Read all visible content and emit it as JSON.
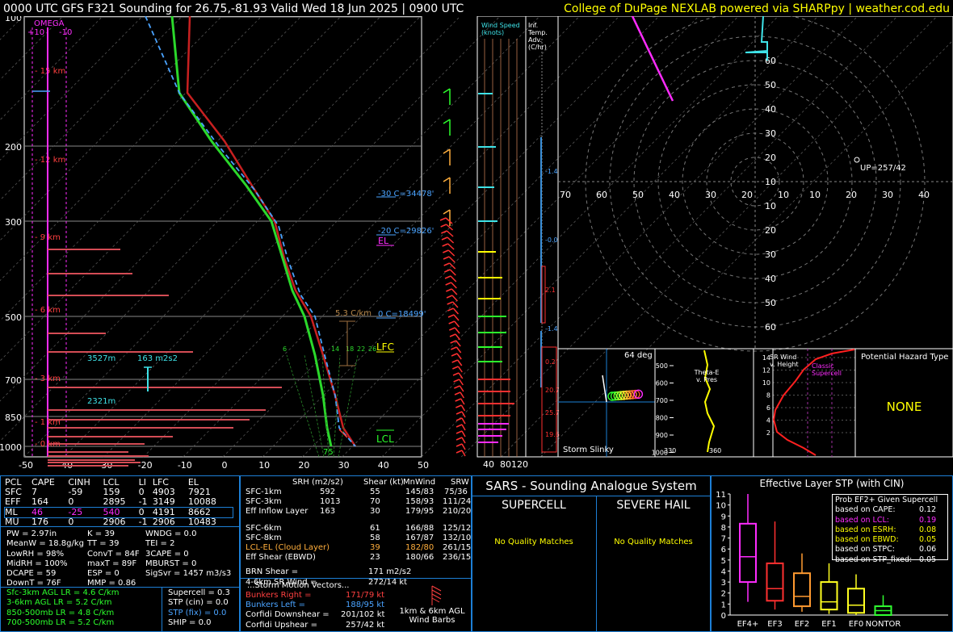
{
  "header": {
    "left_title": "0000 UTC GFS F321 Sounding for 26.75,-81.93 Valid  Wed 18 Jun 2025 | 0900 UTC",
    "right_credit": "College of DuPage NEXLAB powered via SHARPpy | weather.cod.edu"
  },
  "skewt": {
    "omega_label": "OMEGA",
    "omega_ticks": [
      "+10",
      "-10"
    ],
    "pressure_labels": [
      "100",
      "200",
      "300",
      "500",
      "700",
      "850",
      "1000"
    ],
    "temp_labels": [
      "-50",
      "-40",
      "-30",
      "-20",
      "-10",
      "0",
      "10",
      "20",
      "30",
      "40",
      "50"
    ],
    "height_labels": [
      "15 km",
      "12 km",
      "9 km",
      "6 km",
      "3 km",
      "1 km",
      "0 km"
    ],
    "annotations": {
      "minus30": "-30 C=34478'",
      "minus20": "-20 C=29826'",
      "el": "EL",
      "lapse": "5.3 C/km",
      "zero_c": "0 C=18499'",
      "lfc": "LFC",
      "lcl": "LCL",
      "depth": "3527m",
      "srh": "163 m2s2",
      "depth2": "2321m",
      "sfc_temp": "75",
      "mix_ratios": [
        "6",
        "14",
        "18",
        "22",
        "26"
      ]
    }
  },
  "wind_speed": {
    "title": "Wind Speed (knots)",
    "ticks": [
      "40",
      "80",
      "120"
    ]
  },
  "temp_adv": {
    "title": "Inf. Temp. Adv.(C/hr)",
    "values": [
      "-1.4",
      "-0.0",
      "2.1",
      "-1.4",
      "0.2",
      "20.7",
      "25.7",
      "19.6"
    ]
  },
  "hodograph": {
    "ring_labels_x": [
      "70",
      "60",
      "50",
      "40",
      "30",
      "20",
      "10",
      "10",
      "20",
      "30",
      "40",
      "50",
      "60",
      "70"
    ],
    "ring_labels_y_top": [
      "60",
      "50",
      "40",
      "30",
      "20",
      "10"
    ],
    "ring_labels_y_bot": [
      "10",
      "20",
      "30",
      "40",
      "50",
      "60"
    ],
    "upshear": "UP=257/42"
  },
  "storm_slinky": {
    "title": "Storm Slinky",
    "deg": "64 deg"
  },
  "theta_e": {
    "title": "Theta-E v. Pres",
    "pres_ticks": [
      "500",
      "600",
      "700",
      "800",
      "900",
      "1000"
    ],
    "xlabels": [
      "330",
      "360"
    ]
  },
  "sr_wind": {
    "title": "SR Wind v. Height",
    "legend": "Classic Supercell",
    "ticks": [
      "14",
      "12",
      "10",
      "8",
      "6",
      "4",
      "2"
    ]
  },
  "hazard": {
    "title": "Potential Hazard Type",
    "value": "NONE"
  },
  "parcels": {
    "headers": [
      "PCL",
      "CAPE",
      "CINH",
      "LCL",
      "LI",
      "LFC",
      "EL"
    ],
    "rows": [
      [
        "SFC",
        "7",
        "-59",
        "159",
        "0",
        "4903",
        "7921"
      ],
      [
        "EFF",
        "164",
        "0",
        "2895",
        "-1",
        "3149",
        "10088"
      ],
      [
        "ML",
        "46",
        "-25",
        "540",
        "0",
        "4191",
        "8662"
      ],
      [
        "MU",
        "176",
        "0",
        "2906",
        "-1",
        "2906",
        "10483"
      ]
    ]
  },
  "indices": {
    "col1": [
      "PW = 2.97in",
      "MeanW = 18.8g/kg",
      "LowRH = 98%",
      "MidRH = 100%",
      "DCAPE = 59",
      "DownT = 76F"
    ],
    "col2": [
      "K = 39",
      "TT = 39",
      "ConvT = 84F",
      "maxT = 89F",
      "ESP = 0",
      "MMP = 0.86"
    ],
    "col3": [
      "WNDG = 0.0",
      "TEI = 2",
      "3CAPE = 0",
      "MBURST = 0",
      "",
      "SigSvr = 1457 m3/s3"
    ]
  },
  "lapse_rates": {
    "left": [
      "Sfc-3km AGL LR = 4.6 C/km",
      "3-6km AGL LR = 5.2 C/km",
      "850-500mb LR = 4.8 C/km",
      "700-500mb LR = 5.2 C/km"
    ],
    "right": [
      "Supercell = 0.3",
      "STP (cin) = 0.0",
      "STP (fix) = 0.0",
      "SHIP = 0.0"
    ]
  },
  "kinematics": {
    "headers": [
      "SRH (m2/s2)",
      "Shear (kt)",
      "MnWind",
      "SRW"
    ],
    "rows": [
      [
        "SFC-1km",
        "592",
        "55",
        "145/83",
        "75/36"
      ],
      [
        "SFC-3km",
        "1013",
        "70",
        "158/93",
        "111/24"
      ],
      [
        "Eff Inflow Layer",
        "163",
        "30",
        "179/95",
        "210/20"
      ],
      [
        "",
        "",
        "",
        "",
        ""
      ],
      [
        "SFC-6km",
        "61",
        "166/88",
        "125/12",
        ""
      ],
      [
        "SFC-8km",
        "58",
        "167/87",
        "132/10",
        ""
      ],
      [
        "LCL-EL (Cloud Layer)",
        "39",
        "182/80",
        "261/15",
        ""
      ],
      [
        "Eff Shear (EBWD)",
        "23",
        "180/66",
        "236/15",
        ""
      ]
    ],
    "brn_shear_label": "BRN Shear =",
    "brn_shear": "171 m2/s2",
    "sr_wind_label": "4-6km SR Wind =",
    "sr_wind": "272/14 kt",
    "storm_motion_title": "...Storm Motion Vectors...",
    "motions": [
      [
        "Bunkers Right =",
        "171/79 kt"
      ],
      [
        "Bunkers Left =",
        "188/95 kt"
      ],
      [
        "Corfidi Downshear =",
        "201/102 kt"
      ],
      [
        "Corfidi Upshear =",
        "257/42 kt"
      ]
    ],
    "barbs_label": "1km & 6km AGL Wind Barbs"
  },
  "sars": {
    "title": "SARS - Sounding Analogue System",
    "supercell": "SUPERCELL",
    "hail": "SEVERE HAIL",
    "supercell_matches": "No Quality Matches",
    "hail_matches": "No Quality Matches"
  },
  "stp": {
    "title": "Effective Layer STP (with CIN)",
    "prob_title": "Prob EF2+ Given Supercell",
    "probs": [
      [
        "based on CAPE:",
        "0.12"
      ],
      [
        "based on LCL:",
        "0.19"
      ],
      [
        "based on ESRH:",
        "0.08"
      ],
      [
        "based on EBWD:",
        "0.05"
      ],
      [
        "based on STPC:",
        "0.06"
      ],
      [
        "based on STP_fixed:",
        "0.05"
      ]
    ],
    "yticks": [
      "11",
      "10",
      "9",
      "8",
      "7",
      "6",
      "5",
      "4",
      "3",
      "2",
      "1",
      "0"
    ]
  },
  "chart_data": {
    "type": "box",
    "title": "Effective Layer STP (with CIN)",
    "categories": [
      "EF4+",
      "EF3",
      "EF2",
      "EF1",
      "EF0",
      "NONTOR"
    ],
    "colors": [
      "#ff2cff",
      "#ff3030",
      "#ff9a30",
      "#ffff20",
      "#ffff20",
      "#30ff30"
    ],
    "whisker_low": [
      1.2,
      0.5,
      0.3,
      0.1,
      0.0,
      0.0
    ],
    "q1": [
      3.0,
      1.3,
      0.8,
      0.5,
      0.2,
      0.0
    ],
    "median": [
      5.3,
      2.4,
      1.7,
      1.2,
      0.9,
      0.4
    ],
    "q3": [
      8.3,
      4.7,
      3.8,
      3.0,
      2.4,
      0.8
    ],
    "whisker_high": [
      11.0,
      8.5,
      5.6,
      4.7,
      3.7,
      1.8
    ],
    "ylim": [
      0,
      11
    ]
  }
}
